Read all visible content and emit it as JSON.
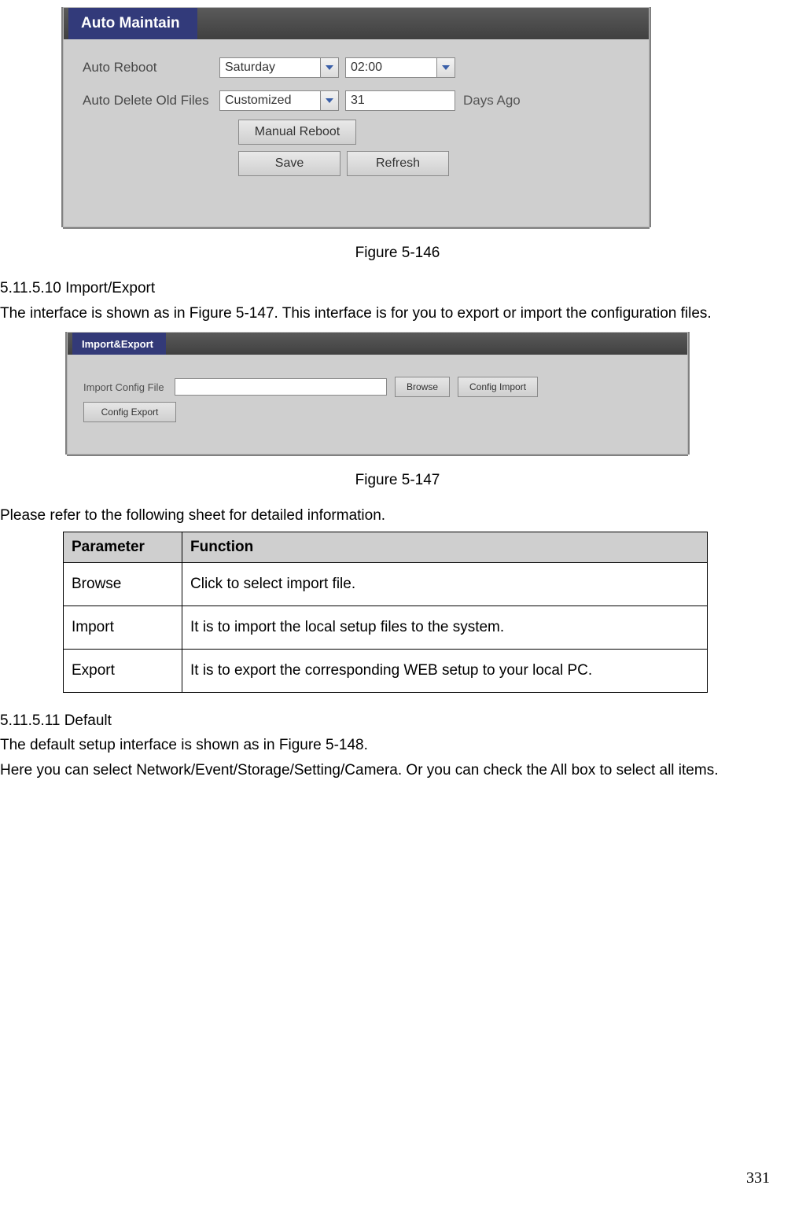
{
  "auto_maintain": {
    "title": "Auto Maintain",
    "row1_label": "Auto Reboot",
    "row1_day": "Saturday",
    "row1_time": "02:00",
    "row2_label": "Auto Delete Old Files",
    "row2_mode": "Customized",
    "row2_days_value": "31",
    "row2_days_trail": "Days Ago",
    "manual_reboot_btn": "Manual Reboot",
    "save_btn": "Save",
    "refresh_btn": "Refresh"
  },
  "fig1_caption": "Figure 5-146",
  "sec1_heading": "5.11.5.10   Import/Export",
  "sec1_text": "The interface is shown as in Figure 5-147. This interface is for you to export or import the configuration files.",
  "import_export": {
    "title": "Import&Export",
    "label": "Import Config File",
    "path_value": "",
    "browse_btn": "Browse",
    "import_btn": "Config Import",
    "export_btn": "Config Export"
  },
  "fig2_caption": "Figure 5-147",
  "table_intro": "Please refer to the following sheet for detailed information.",
  "table": {
    "head_param": "Parameter",
    "head_func": "Function",
    "rows": [
      {
        "param": "Browse",
        "func": "Click to select import file."
      },
      {
        "param": "Import",
        "func": "It is to import the local setup files to the system."
      },
      {
        "param": "Export",
        "func": "It is to export the corresponding WEB setup to your local PC."
      }
    ]
  },
  "sec2_heading": "5.11.5.11   Default",
  "sec2_text_l1": "The default setup interface is shown as in Figure 5-148.",
  "sec2_text_l2": "Here you can select Network/Event/Storage/Setting/Camera. Or you can check the All box to select all items.",
  "page_number": "331"
}
